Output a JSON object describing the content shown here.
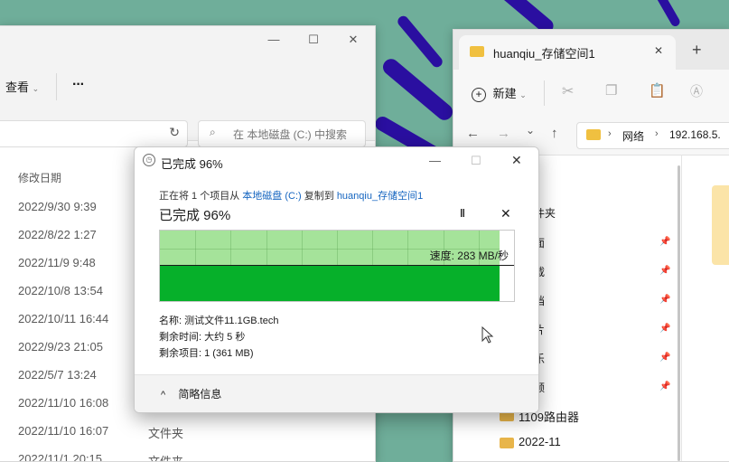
{
  "left_window": {
    "view_label": "查看",
    "more_label": "···",
    "search_placeholder": "在 本地磁盘 (C:) 中搜索",
    "column_modified": "修改日期",
    "rows": [
      {
        "date": "2022/9/30 9:39",
        "type": ""
      },
      {
        "date": "2022/8/22 1:27",
        "type": ""
      },
      {
        "date": "2022/11/9 9:48",
        "type": ""
      },
      {
        "date": "2022/10/8 13:54",
        "type": ""
      },
      {
        "date": "2022/10/11 16:44",
        "type": ""
      },
      {
        "date": "2022/9/23 21:05",
        "type": ""
      },
      {
        "date": "2022/5/7 13:24",
        "type": ""
      },
      {
        "date": "2022/11/10 16:08",
        "type": ""
      },
      {
        "date": "2022/11/10 16:07",
        "type": "文件夹"
      },
      {
        "date": "2022/11/1 20:15",
        "type": "文件夹"
      }
    ]
  },
  "right_window": {
    "tab_title": "huanqiu_存储空间1",
    "new_label": "新建",
    "breadcrumb_network": "网络",
    "breadcrumb_ip": "192.168.5.",
    "sidebar_partial": [
      "件夹",
      "面",
      "载",
      "档",
      "片",
      "乐",
      "频"
    ],
    "folders": [
      "1109路由器",
      "2022-11"
    ]
  },
  "dialog": {
    "title": "已完成 96%",
    "copy_prefix": "正在将 1 个项目从 ",
    "source": "本地磁盘 (C:)",
    "copy_mid": " 复制到 ",
    "destination": "huanqiu_存储空间1",
    "percent_label": "已完成 96%",
    "progress": 0.96,
    "speed_level": 0.5,
    "speed_label": "速度: 283 MB/秒",
    "name_label": "名称: 测试文件11.1GB.tech",
    "time_label": "剩余时间: 大约 5 秒",
    "items_label": "剩余项目: 1 (361 MB)",
    "details_label": "简略信息"
  },
  "colors": {
    "graph_done": "#a5e39a",
    "graph_speed": "#06b02a",
    "link": "#1565c0",
    "folder": "#e8b54a",
    "wallpaper": "#6fae9a"
  }
}
